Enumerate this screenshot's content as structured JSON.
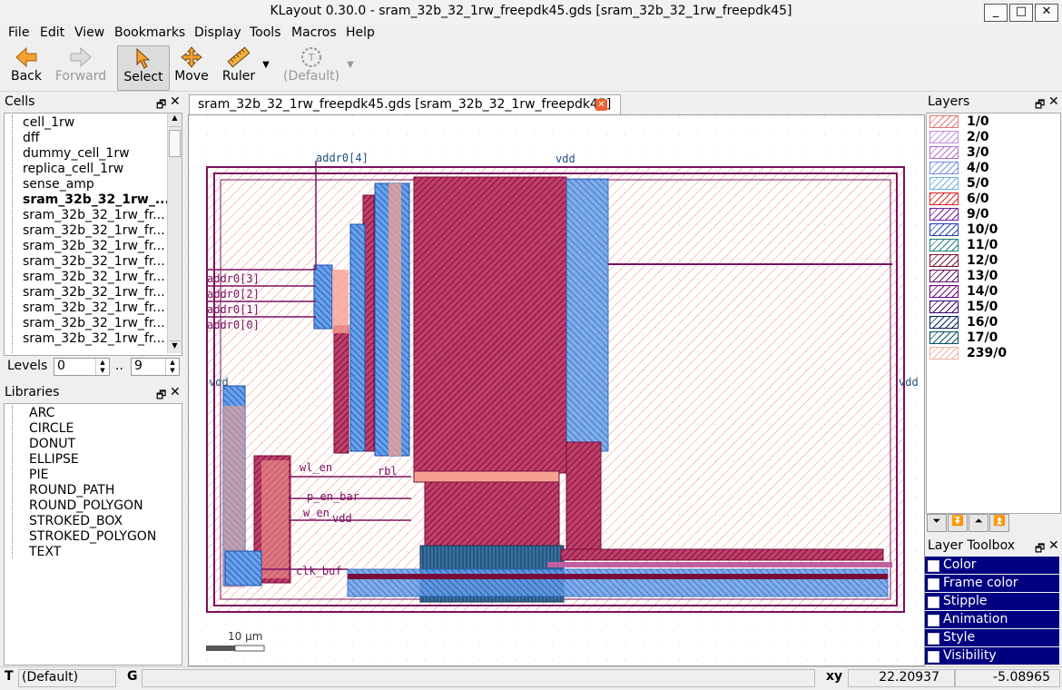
{
  "window": {
    "title": "KLayout 0.30.0 - sram_32b_32_1rw_freepdk45.gds [sram_32b_32_1rw_freepdk45]",
    "btn_minimize": "_",
    "btn_maximize": "□",
    "btn_close": "✕"
  },
  "menu": [
    "File",
    "Edit",
    "View",
    "Bookmarks",
    "Display",
    "Tools",
    "Macros",
    "Help"
  ],
  "toolbar": {
    "back": "Back",
    "forward": "Forward",
    "select": "Select",
    "move": "Move",
    "ruler": "Ruler",
    "default": "(Default)"
  },
  "cells_panel": {
    "title": "Cells",
    "items": [
      "cell_1rw",
      "dff",
      "dummy_cell_1rw",
      "replica_cell_1rw",
      "sense_amp",
      "sram_32b_32_1rw_...",
      "sram_32b_32_1rw_fr...",
      "sram_32b_32_1rw_fr...",
      "sram_32b_32_1rw_fr...",
      "sram_32b_32_1rw_fr...",
      "sram_32b_32_1rw_fr...",
      "sram_32b_32_1rw_fr...",
      "sram_32b_32_1rw_fr...",
      "sram_32b_32_1rw_fr...",
      "sram_32b_32_1rw_fr..."
    ],
    "selected_index": 5,
    "levels_label": "Levels",
    "levels_from": "0",
    "levels_sep": "..",
    "levels_to": "9"
  },
  "libraries_panel": {
    "title": "Libraries",
    "items": [
      "ARC",
      "CIRCLE",
      "DONUT",
      "ELLIPSE",
      "PIE",
      "ROUND_PATH",
      "ROUND_POLYGON",
      "STROKED_BOX",
      "STROKED_POLYGON",
      "TEXT"
    ]
  },
  "tab": {
    "label": "sram_32b_32_1rw_freepdk45.gds [sram_32b_32_1rw_freepdk45]"
  },
  "canvas_labels": {
    "addr4": "addr0[4]",
    "addr3": "addr0[3]",
    "addr2": "addr0[2]",
    "addr1": "addr0[1]",
    "addr0": "addr0[0]",
    "vdd_top": "vdd",
    "vdd_left": "vdd",
    "vdd_right": "vdd",
    "wl_en": "wl_en",
    "rbl": "rbl",
    "p_en_bar": "p_en_bar",
    "w_en": "w_en",
    "clk_buf": "clk_buf",
    "scale": "10 µm"
  },
  "layers_panel": {
    "title": "Layers",
    "layers": [
      {
        "name": "1/0",
        "color": "#e87878"
      },
      {
        "name": "2/0",
        "color": "#c090e0"
      },
      {
        "name": "3/0",
        "color": "#b070d0"
      },
      {
        "name": "4/0",
        "color": "#7090e0"
      },
      {
        "name": "5/0",
        "color": "#70b0e0"
      },
      {
        "name": "6/0",
        "color": "#e02020"
      },
      {
        "name": "9/0",
        "color": "#7020a0"
      },
      {
        "name": "10/0",
        "color": "#2040c0"
      },
      {
        "name": "11/0",
        "color": "#208080"
      },
      {
        "name": "12/0",
        "color": "#801030"
      },
      {
        "name": "13/0",
        "color": "#601060"
      },
      {
        "name": "14/0",
        "color": "#700080"
      },
      {
        "name": "15/0",
        "color": "#400070"
      },
      {
        "name": "16/0",
        "color": "#002060"
      },
      {
        "name": "17/0",
        "color": "#005060"
      },
      {
        "name": "239/0",
        "color": "#f0b0a0"
      }
    ]
  },
  "layer_toolbox": {
    "title": "Layer Toolbox",
    "items": [
      "Color",
      "Frame color",
      "Stipple",
      "Animation",
      "Style",
      "Visibility"
    ]
  },
  "status": {
    "mode_key": "T",
    "mode_value": "(Default)",
    "grid_key": "G",
    "coord_key": "xy",
    "x": "22.20937",
    "y": "-5.08965"
  }
}
